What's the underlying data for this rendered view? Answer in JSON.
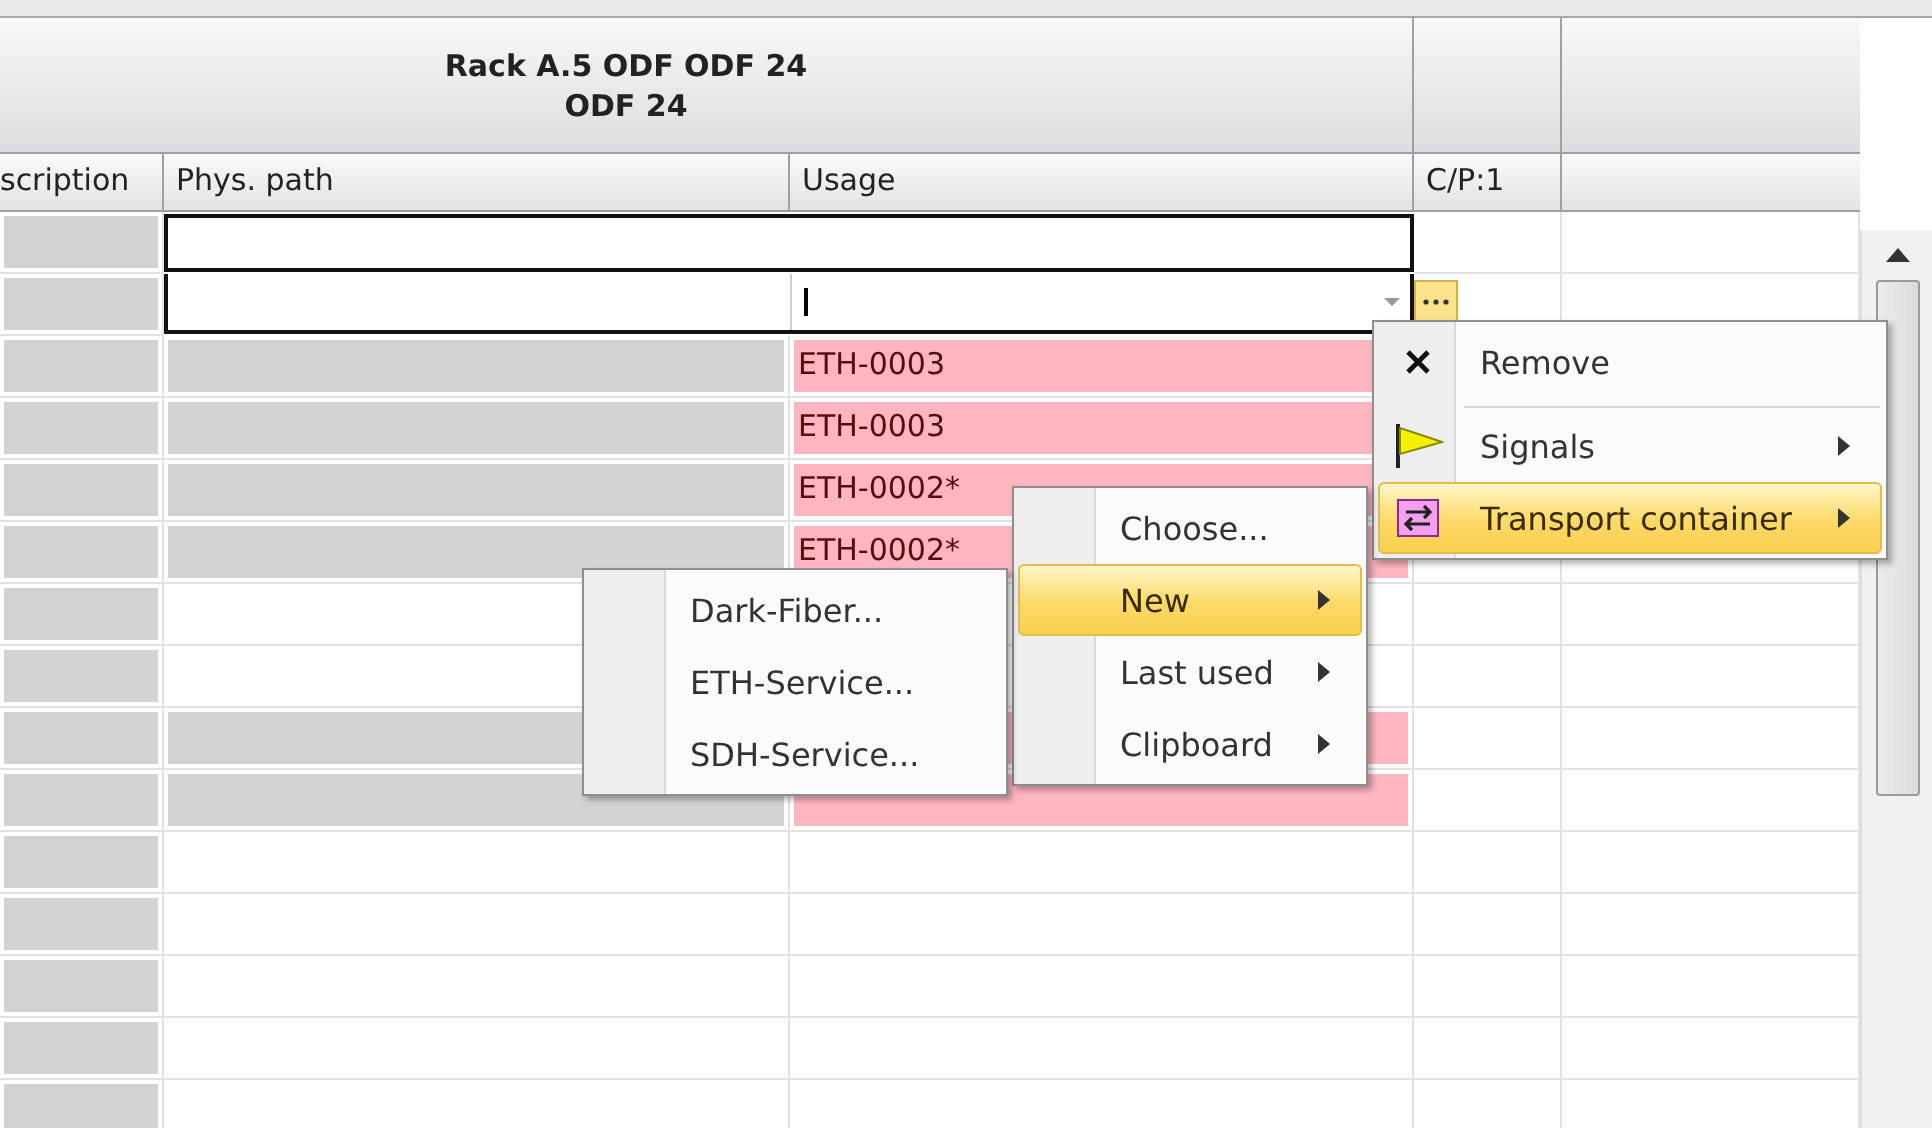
{
  "table": {
    "group_title": "Rack A.5 ODF ODF 24\nODF 24",
    "columns": [
      "scription",
      "Phys. path",
      "Usage",
      "C/P:1"
    ],
    "rows": [
      {
        "kind": "focus"
      },
      {
        "kind": "editor"
      },
      {
        "kind": "data",
        "desc_shaded": true,
        "phys_shaded": true,
        "usage": "ETH-0003",
        "flagged": true
      },
      {
        "kind": "data",
        "desc_shaded": true,
        "phys_shaded": true,
        "usage": "ETH-0003",
        "flagged": true
      },
      {
        "kind": "data",
        "desc_shaded": true,
        "phys_shaded": true,
        "usage": "ETH-0002*",
        "flagged": true
      },
      {
        "kind": "data",
        "desc_shaded": true,
        "phys_shaded": true,
        "usage": "ETH-0002*",
        "flagged": true
      },
      {
        "kind": "data",
        "desc_shaded": true,
        "phys_shaded": false,
        "flagged": false
      },
      {
        "kind": "data",
        "desc_shaded": true,
        "phys_shaded": false,
        "flagged": false
      },
      {
        "kind": "data",
        "desc_shaded": true,
        "phys_shaded": true,
        "flagged": true
      },
      {
        "kind": "data",
        "desc_shaded": true,
        "phys_shaded": true,
        "flagged": true
      },
      {
        "kind": "data",
        "desc_shaded": true,
        "phys_shaded": false,
        "flagged": false
      },
      {
        "kind": "data",
        "desc_shaded": true,
        "phys_shaded": false,
        "flagged": false
      },
      {
        "kind": "data",
        "desc_shaded": true,
        "phys_shaded": false,
        "flagged": false
      },
      {
        "kind": "data",
        "desc_shaded": true,
        "phys_shaded": false,
        "flagged": false
      },
      {
        "kind": "data",
        "desc_shaded": true,
        "phys_shaded": false,
        "flagged": false
      }
    ]
  },
  "context_menu": {
    "items": [
      {
        "label": "Remove",
        "submenu": false,
        "selected": false,
        "separator_after": true
      },
      {
        "label": "Signals",
        "submenu": true,
        "selected": false,
        "separator_after": false
      },
      {
        "label": "Transport container",
        "submenu": true,
        "selected": true,
        "separator_after": false
      }
    ]
  },
  "submenu": {
    "items": [
      {
        "label": "Choose...",
        "submenu": false,
        "selected": false
      },
      {
        "label": "New",
        "submenu": true,
        "selected": true
      },
      {
        "label": "Last used",
        "submenu": true,
        "selected": false
      },
      {
        "label": "Clipboard",
        "submenu": true,
        "selected": false
      }
    ]
  },
  "new_submenu": {
    "items": [
      {
        "label": "Dark-Fiber...",
        "submenu": false,
        "selected": false
      },
      {
        "label": "ETH-Service...",
        "submenu": false,
        "selected": false
      },
      {
        "label": "SDH-Service...",
        "submenu": false,
        "selected": false
      }
    ]
  }
}
